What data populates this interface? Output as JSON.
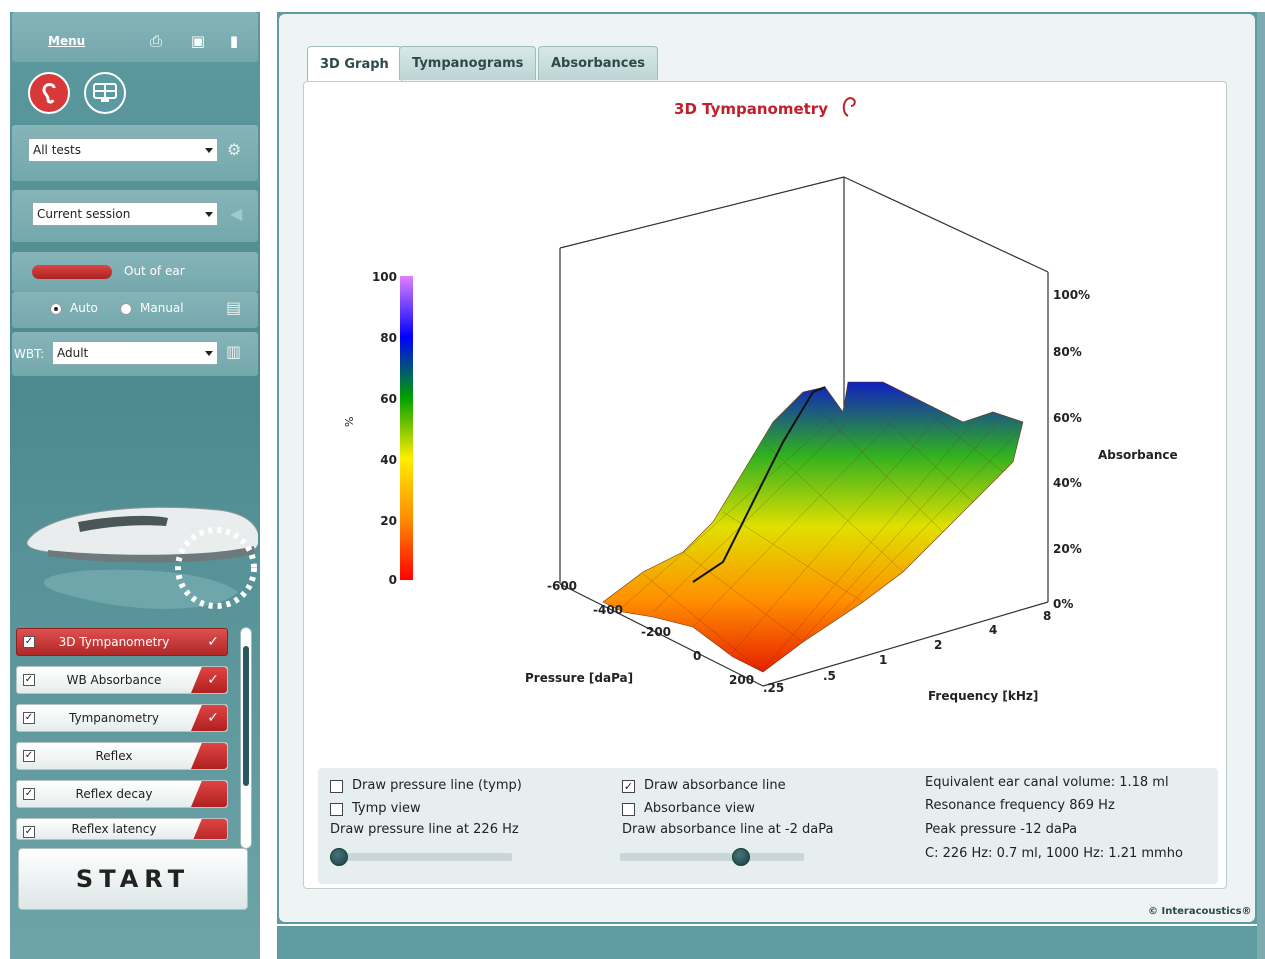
{
  "left": {
    "menu_label": "Menu",
    "tests_dropdown": "All tests",
    "session_dropdown": "Current session",
    "status_text": "Out of ear",
    "mode_auto": "Auto",
    "mode_manual": "Manual",
    "wbt_label": "WBT:",
    "wbt_value": "Adult",
    "tests": [
      {
        "name": "3D Tympanometry",
        "checked": true,
        "done": true,
        "active": true
      },
      {
        "name": "WB Absorbance",
        "checked": true,
        "done": true,
        "active": false
      },
      {
        "name": "Tympanometry",
        "checked": true,
        "done": true,
        "active": false
      },
      {
        "name": "Reflex",
        "checked": true,
        "done": false,
        "active": false
      },
      {
        "name": "Reflex decay",
        "checked": true,
        "done": false,
        "active": false
      },
      {
        "name": "Reflex latency",
        "checked": true,
        "done": false,
        "active": false
      }
    ],
    "start_label": "START"
  },
  "tabs": [
    "3D Graph",
    "Tympanograms",
    "Absorbances"
  ],
  "active_tab": "3D Graph",
  "chart_data": {
    "type": "area",
    "title": "3D Tympanometry",
    "pressure_axis": {
      "label": "Pressure [daPa]",
      "ticks": [
        "-600",
        "-400",
        "-200",
        "0",
        "200"
      ]
    },
    "frequency_axis": {
      "label": "Frequency [kHz]",
      "ticks": [
        ".25",
        ".5",
        "1",
        "2",
        "4",
        "8"
      ]
    },
    "absorbance_axis": {
      "label": "Absorbance",
      "ticks": [
        "0%",
        "20%",
        "40%",
        "60%",
        "80%",
        "100%"
      ]
    },
    "colorbar": {
      "label": "%",
      "ticks": [
        "0",
        "20",
        "40",
        "60",
        "80",
        "100"
      ],
      "range": [
        0,
        100
      ]
    },
    "absorbance_by_frequency": {
      "frequency_khz": [
        0.25,
        0.5,
        1,
        2,
        4,
        8
      ],
      "peak_absorbance_pct": [
        5,
        30,
        70,
        80,
        65,
        60
      ]
    }
  },
  "controls": {
    "draw_pressure_line": {
      "label": "Draw pressure line (tymp)",
      "checked": false
    },
    "tymp_view": {
      "label": "Tymp view",
      "checked": false
    },
    "pressure_line_caption": "Draw pressure line at 226 Hz",
    "pressure_slider_fraction": 0.05,
    "draw_absorbance_line": {
      "label": "Draw absorbance line",
      "checked": true
    },
    "absorbance_view": {
      "label": "Absorbance view",
      "checked": false
    },
    "absorbance_line_caption": "Draw absorbance line at -2 daPa",
    "absorbance_slider_fraction": 0.65
  },
  "results": {
    "ear_canal_volume": "Equivalent ear canal volume: 1.18 ml",
    "resonance": "Resonance frequency 869 Hz",
    "peak_pressure": "Peak pressure -12 daPa",
    "compliance": "C: 226 Hz: 0.7 ml, 1000 Hz: 1.21 mmho"
  },
  "copyright": "© Interacoustics®"
}
